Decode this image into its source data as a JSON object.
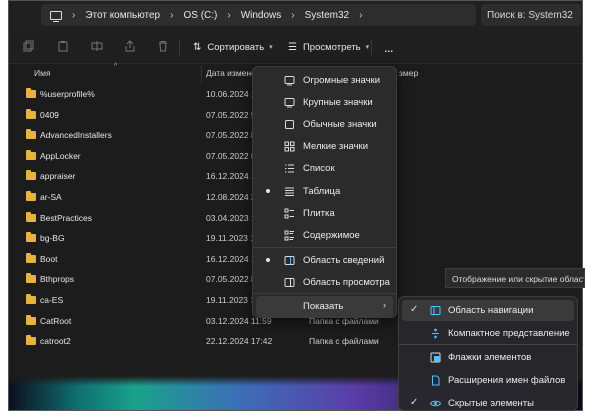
{
  "address_bar": {
    "crumbs": [
      "Этот компьютер",
      "OS (C:)",
      "Windows",
      "System32"
    ],
    "search_placeholder": "Поиск в: System32"
  },
  "toolbar": {
    "sort_label": "Сортировать",
    "view_label": "Просмотреть",
    "more_label": "..."
  },
  "columns": {
    "name": "Имя",
    "date": "Дата измене",
    "size": "змер"
  },
  "files": [
    {
      "name": "%userprofile%",
      "date": "10.06.2024 1",
      "type": ""
    },
    {
      "name": "0409",
      "date": "07.05.2022 5",
      "type": ""
    },
    {
      "name": "AdvancedInstallers",
      "date": "07.05.2022 8",
      "type": ""
    },
    {
      "name": "AppLocker",
      "date": "07.05.2022 8",
      "type": ""
    },
    {
      "name": "appraiser",
      "date": "16.12.2024 1",
      "type": ""
    },
    {
      "name": "ar-SA",
      "date": "12.08.2024 2",
      "type": ""
    },
    {
      "name": "BestPractices",
      "date": "03.04.2023 1",
      "type": ""
    },
    {
      "name": "bg-BG",
      "date": "19.11.2023 1",
      "type": ""
    },
    {
      "name": "Boot",
      "date": "16.12.2024 1",
      "type": ""
    },
    {
      "name": "Bthprops",
      "date": "07.05.2022 8",
      "type": ""
    },
    {
      "name": "ca-ES",
      "date": "19.11.2023 1",
      "type": ""
    },
    {
      "name": "CatRoot",
      "date": "03.12.2024 11:59",
      "type": "Папка с файлами"
    },
    {
      "name": "catroot2",
      "date": "22.12.2024 17:42",
      "type": "Папка с файлами"
    }
  ],
  "view_menu": {
    "items": [
      {
        "label": "Огромные значки",
        "icon": "monitor-icon"
      },
      {
        "label": "Крупные значки",
        "icon": "monitor-icon"
      },
      {
        "label": "Обычные значки",
        "icon": "square-icon"
      },
      {
        "label": "Мелкие значки",
        "icon": "grid-icon"
      },
      {
        "label": "Список",
        "icon": "list-icon"
      },
      {
        "label": "Таблица",
        "icon": "details-icon",
        "selected": true
      },
      {
        "label": "Плитка",
        "icon": "tiles-icon"
      },
      {
        "label": "Содержимое",
        "icon": "content-icon"
      },
      {
        "label": "Область сведений",
        "icon": "details-pane-icon",
        "selected": true
      },
      {
        "label": "Область просмотра",
        "icon": "preview-pane-icon"
      },
      {
        "label": "Показать",
        "icon": "",
        "has_submenu": true
      }
    ]
  },
  "show_submenu": {
    "items": [
      {
        "label": "Область навигации",
        "checked": true,
        "icon": "navigation-pane-icon"
      },
      {
        "label": "Компактное представление",
        "checked": false,
        "icon": "compact-view-icon"
      },
      {
        "label": "Флажки элементов",
        "checked": false,
        "icon": "checkbox-icon"
      },
      {
        "label": "Расширения имен файлов",
        "checked": false,
        "icon": "file-icon"
      },
      {
        "label": "Скрытые элементы",
        "checked": true,
        "icon": "eye-icon"
      }
    ]
  },
  "tooltip": {
    "text": "Отображение или скрытие области навигации"
  },
  "colors": {
    "folder": "#e7b33e",
    "accent": "#4cc2ff",
    "menu_bg": "#2b2b2b",
    "window_bg": "#1c1c1c"
  }
}
